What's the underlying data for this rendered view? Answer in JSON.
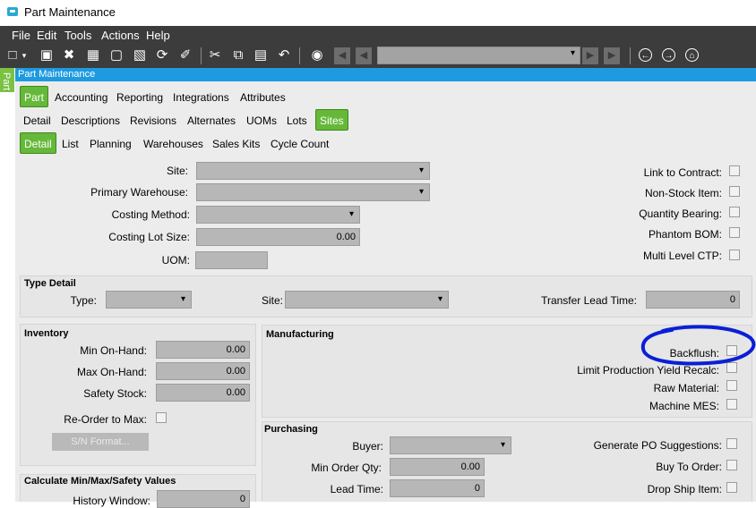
{
  "window": {
    "title": "Part Maintenance"
  },
  "menu": {
    "items": [
      "File",
      "Edit",
      "Tools",
      "Actions",
      "Help"
    ]
  },
  "side_tab": {
    "label": "Part"
  },
  "form_header": {
    "title": "Part Maintenance"
  },
  "tabs_level1": [
    {
      "label": "Part",
      "selected": true
    },
    {
      "label": "Accounting"
    },
    {
      "label": "Reporting"
    },
    {
      "label": "Integrations"
    },
    {
      "label": "Attributes"
    }
  ],
  "tabs_level2": [
    {
      "label": "Detail"
    },
    {
      "label": "Descriptions"
    },
    {
      "label": "Revisions"
    },
    {
      "label": "Alternates"
    },
    {
      "label": "UOMs"
    },
    {
      "label": "Lots"
    },
    {
      "label": "Sites",
      "selected": true
    }
  ],
  "tabs_level3": [
    {
      "label": "Detail",
      "selected": true
    },
    {
      "label": "List"
    },
    {
      "label": "Planning"
    },
    {
      "label": "Warehouses"
    },
    {
      "label": "Sales Kits"
    },
    {
      "label": "Cycle Count"
    }
  ],
  "site_fields": {
    "site_label": "Site:",
    "primary_warehouse_label": "Primary Warehouse:",
    "costing_method_label": "Costing Method:",
    "costing_lot_size_label": "Costing Lot Size:",
    "costing_lot_size_value": "0.00",
    "uom_label": "UOM:"
  },
  "right_checks": {
    "link_to_contract": "Link to Contract:",
    "non_stock_item": "Non-Stock Item:",
    "quantity_bearing": "Quantity Bearing:",
    "phantom_bom": "Phantom BOM:",
    "multi_level_ctp": "Multi Level CTP:"
  },
  "type_detail": {
    "header": "Type Detail",
    "type_label": "Type:",
    "site_label": "Site:",
    "transfer_lead_time_label": "Transfer Lead Time:",
    "transfer_lead_time_value": "0"
  },
  "inventory": {
    "header": "Inventory",
    "min_on_hand_label": "Min On-Hand:",
    "min_on_hand_value": "0.00",
    "max_on_hand_label": "Max On-Hand:",
    "max_on_hand_value": "0.00",
    "safety_stock_label": "Safety Stock:",
    "safety_stock_value": "0.00",
    "reorder_to_max_label": "Re-Order to Max:",
    "sn_format_button": "S/N Format..."
  },
  "calc": {
    "header": "Calculate Min/Max/Safety Values",
    "history_window_label": "History Window:",
    "history_window_value": "0"
  },
  "manufacturing": {
    "header": "Manufacturing",
    "backflush_label": "Backflush:",
    "limit_yield_label": "Limit Production Yield Recalc:",
    "raw_material_label": "Raw Material:",
    "machine_mes_label": "Machine MES:"
  },
  "purchasing": {
    "header": "Purchasing",
    "buyer_label": "Buyer:",
    "min_order_qty_label": "Min Order Qty:",
    "min_order_qty_value": "0.00",
    "lead_time_label": "Lead Time:",
    "lead_time_value": "0",
    "generate_po_label": "Generate PO Suggestions:",
    "buy_to_order_label": "Buy To Order:",
    "drop_ship_label": "Drop Ship Item:"
  },
  "colors": {
    "accent_green": "#66b83a",
    "header_blue": "#1e9be0",
    "toolbar_dark": "#3c3c3c",
    "annotation_blue": "#0a1fd6"
  },
  "annotation": {
    "shape": "hand-drawn circle around Backflush"
  }
}
